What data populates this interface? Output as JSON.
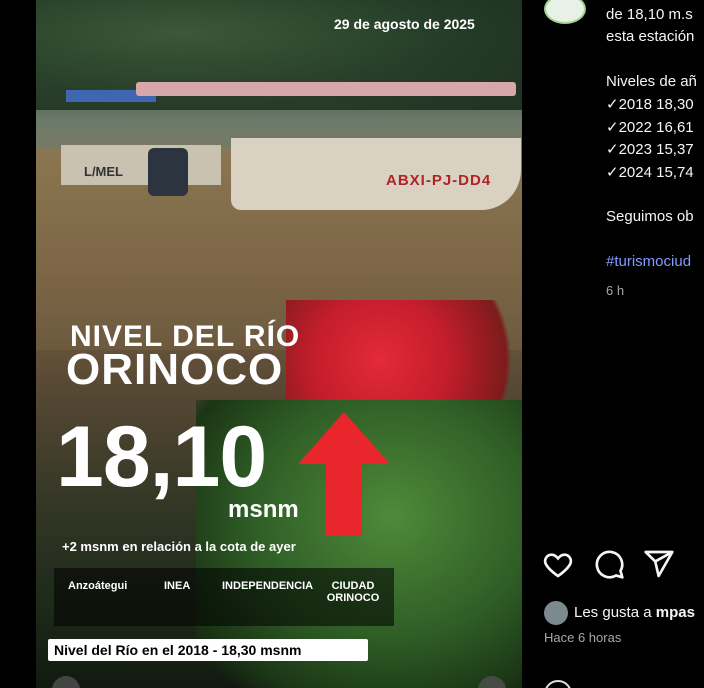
{
  "media": {
    "date": "29 de agosto de 2025",
    "title_line1": "NIVEL DEL RÍO",
    "title_line2": "ORINOCO",
    "level_value": "18,10",
    "level_unit": "msnm",
    "caption": "+2 msnm en relación a la cota de ayer",
    "boat_registration": "ABXI-PJ-DD4",
    "boat_small_label": "L/MEL",
    "logos": [
      "Anzoátegui",
      "INEA",
      "INDEPENDENCIA",
      "CIUDAD ORINOCO"
    ],
    "banner": "Nivel del Río en el 2018 - 18,30 msnm",
    "trend_icon": "red-up-arrow"
  },
  "post": {
    "caption_lines": [
      "de 18,10 m.s",
      "esta estación",
      "Niveles de añ",
      "✓2018 18,30",
      "✓2022 16,61",
      "✓2023 15,37",
      "✓2024 15,74",
      "Seguimos ob",
      "#turismociud"
    ],
    "relative_time": "6 h",
    "likes_prefix": "Les gusta a",
    "likes_user": "mpas",
    "posted_ago": "Hace 6 horas"
  },
  "icons": [
    "heart-icon",
    "comment-icon",
    "share-icon"
  ],
  "colors": {
    "arrow": "#e8262c",
    "hashtag": "#7f9dff",
    "background": "#000000"
  }
}
